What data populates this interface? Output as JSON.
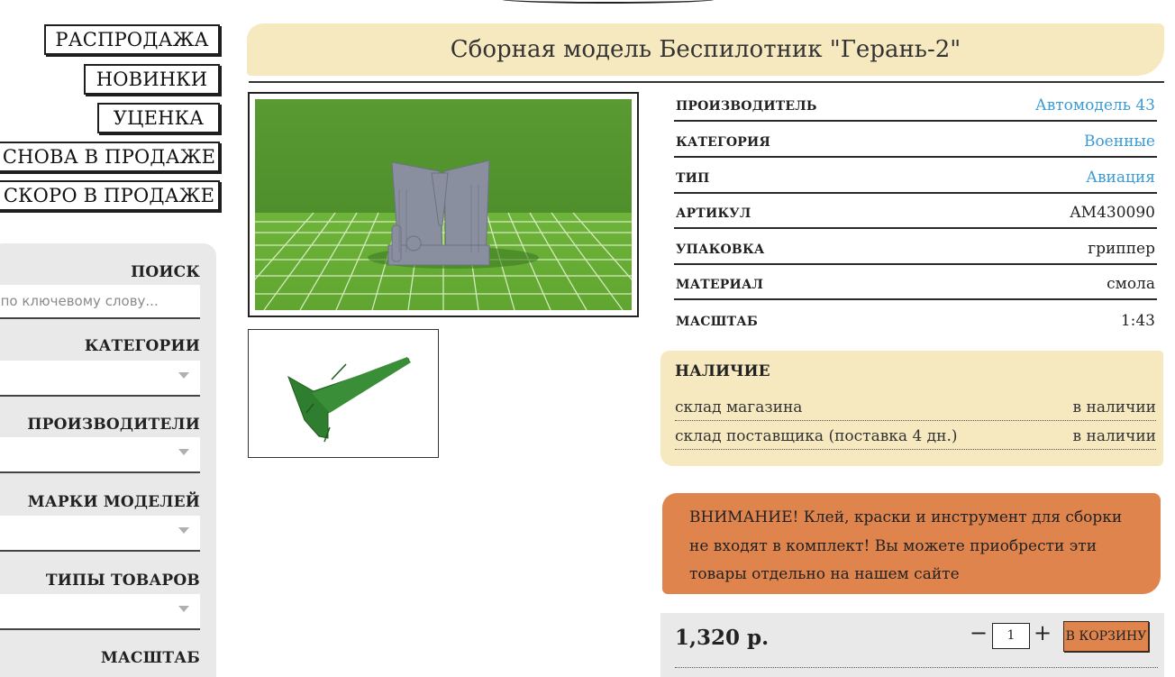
{
  "nav": {
    "items": [
      {
        "label": "РАСПРОДАЖА"
      },
      {
        "label": "НОВИНКИ"
      },
      {
        "label": "УЦЕНКА"
      },
      {
        "label": "СНОВА В ПРОДАЖЕ"
      },
      {
        "label": "СКОРО В ПРОДАЖЕ"
      }
    ]
  },
  "filters": {
    "search_title": "ПОИСК",
    "search_placeholder": "искать по ключевому слову...",
    "categories_title": "КАТЕГОРИИ",
    "manufacturers_title": "ПРОИЗВОДИТЕЛИ",
    "brands_title": "МАРКИ МОДЕЛЕЙ",
    "types_title": "ТИПЫ ТОВАРОВ",
    "scale_title": "МАСШТАБ"
  },
  "product": {
    "title": "Сборная модель Беспилотник \"Герань-2\"",
    "specs": [
      {
        "key": "ПРОИЗВОДИТЕЛЬ",
        "value": "Автомодель 43",
        "link": true
      },
      {
        "key": "КАТЕГОРИЯ",
        "value": "Военные",
        "link": true
      },
      {
        "key": "ТИП",
        "value": "Авиация",
        "link": true
      },
      {
        "key": "АРТИКУЛ",
        "value": "AM430090",
        "link": false
      },
      {
        "key": "УПАКОВКА",
        "value": "гриппер",
        "link": false
      },
      {
        "key": "МАТЕРИАЛ",
        "value": "смола",
        "link": false
      },
      {
        "key": "МАСШТАБ",
        "value": "1:43",
        "link": false
      }
    ]
  },
  "availability": {
    "title": "НАЛИЧИЕ",
    "rows": [
      {
        "place": "склад магазина",
        "status": "в наличии"
      },
      {
        "place": "склад поставщика (поставка 4 дн.)",
        "status": "в наличии"
      }
    ]
  },
  "warning": {
    "text": "ВНИМАНИЕ! Клей, краски и инструмент для сборки не входят в комплект! Вы можете приобрести эти товары отдельно на нашем сайте"
  },
  "purchase": {
    "price": "1,320 р.",
    "minus": "−",
    "plus": "+",
    "quantity": "1",
    "cart_label": "В КОРЗИНУ"
  },
  "colors": {
    "banner": "#f6e8bf",
    "link": "#3a9bd5",
    "warning": "#e0844d",
    "panel": "#e9e9e9"
  }
}
